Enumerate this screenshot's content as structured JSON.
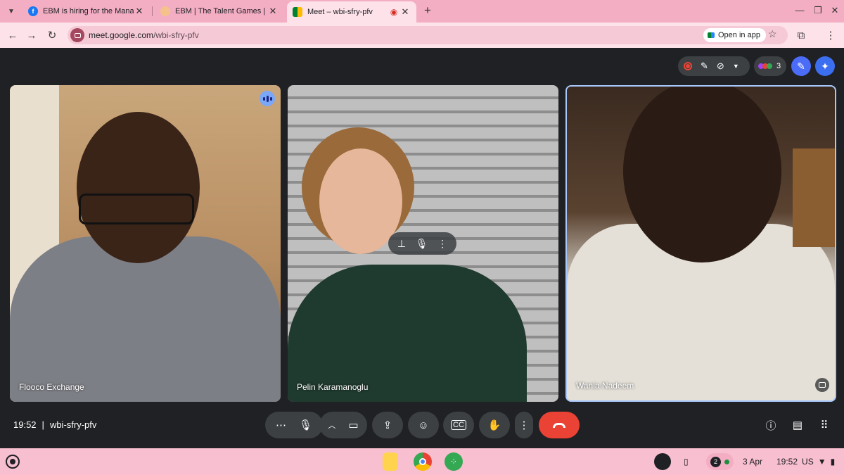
{
  "browser": {
    "tabs": [
      {
        "title": "EBM is hiring for the Managem",
        "favicon": "facebook-icon",
        "color": "#1877f2"
      },
      {
        "title": "EBM | The Talent Games | C-Fa",
        "favicon": "page-icon",
        "color": "#f4a460"
      },
      {
        "title": "Meet – wbi-sfry-pfv",
        "favicon": "meet-icon",
        "color": "#00832d",
        "active": true
      }
    ],
    "url_host": "meet.google.com",
    "url_path": "/wbi-sfry-pfv",
    "open_in_app": "Open in app"
  },
  "meet": {
    "participant_count": "3",
    "tiles": [
      {
        "name": "Flooco Exchange"
      },
      {
        "name": "Pelin Karamanoglu"
      },
      {
        "name": "Wania Nadeem"
      }
    ],
    "time": "19:52",
    "separator": "|",
    "meeting_code": "wbi-sfry-pfv",
    "colors": {
      "accent": "#a8c7fa",
      "hangup": "#ea4335",
      "speaking": "#7aa7f7"
    }
  },
  "shelf": {
    "notifications": "2",
    "date": "3 Apr",
    "time": "19:52",
    "locale": "US"
  }
}
